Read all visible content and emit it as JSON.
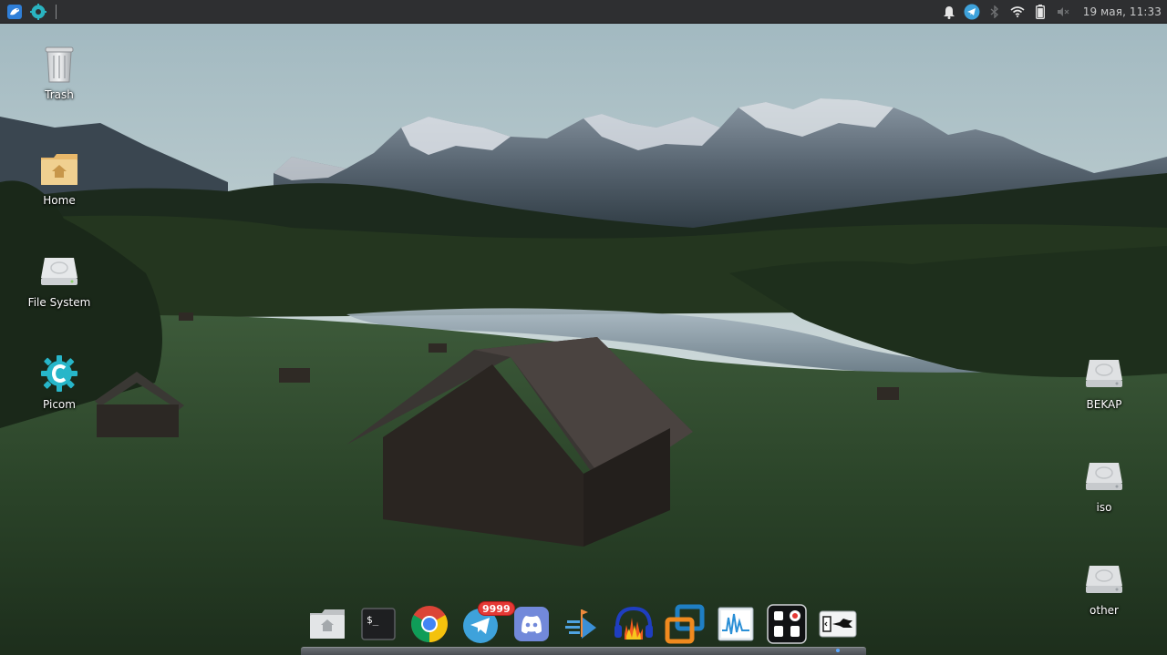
{
  "top_panel": {
    "left_items": [
      {
        "name": "app-menu",
        "icon": "bird-logo-icon"
      },
      {
        "name": "settings",
        "icon": "gear-icon"
      }
    ],
    "tray": [
      {
        "name": "notifications",
        "icon": "bell-icon"
      },
      {
        "name": "telegram",
        "icon": "telegram-icon"
      },
      {
        "name": "bluetooth",
        "icon": "bluetooth-icon"
      },
      {
        "name": "wifi",
        "icon": "wifi-icon"
      },
      {
        "name": "battery",
        "icon": "battery-icon"
      },
      {
        "name": "volume",
        "icon": "volume-muted-icon"
      }
    ],
    "clock": "19 мая, 11:33"
  },
  "desktop": {
    "left_icons": [
      {
        "label": "Trash",
        "icon": "trash-icon"
      },
      {
        "label": "Home",
        "icon": "home-folder-icon"
      },
      {
        "label": "File System",
        "icon": "drive-icon"
      },
      {
        "label": "Picom",
        "icon": "gear-icon"
      }
    ],
    "right_icons": [
      {
        "label": "BEKAP",
        "icon": "drive-icon"
      },
      {
        "label": "iso",
        "icon": "drive-icon"
      },
      {
        "label": "other",
        "icon": "drive-icon"
      }
    ]
  },
  "dock": {
    "items": [
      {
        "name": "files",
        "icon": "home-folder-icon"
      },
      {
        "name": "terminal",
        "icon": "terminal-icon",
        "text": "$_"
      },
      {
        "name": "chrome",
        "icon": "chrome-icon"
      },
      {
        "name": "telegram",
        "icon": "telegram-icon",
        "badge": "9999"
      },
      {
        "name": "discord",
        "icon": "discord-icon"
      },
      {
        "name": "qbittorrent-like",
        "icon": "arrow-flag-icon"
      },
      {
        "name": "audacity",
        "icon": "audacity-icon"
      },
      {
        "name": "virtualbox",
        "icon": "virtualbox-icon"
      },
      {
        "name": "system-monitor",
        "icon": "monitor-icon"
      },
      {
        "name": "mixer",
        "icon": "mixer-icon"
      },
      {
        "name": "last-app",
        "icon": "plug-icon"
      }
    ]
  },
  "colors": {
    "panel_bg": "#2e2f31",
    "accent": "#5aa7ff",
    "badge": "#e53935"
  }
}
